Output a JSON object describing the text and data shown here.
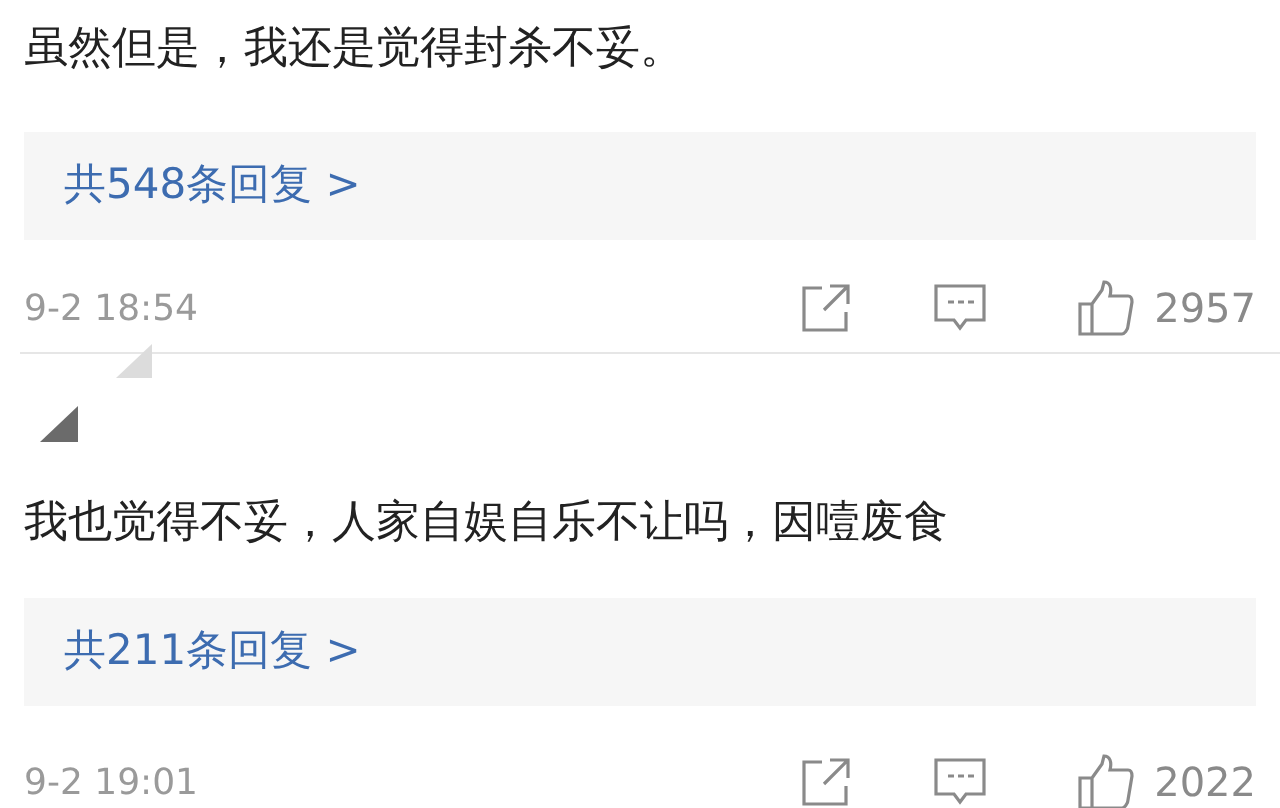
{
  "comments": [
    {
      "text": "虽然但是，我还是觉得封杀不妥。",
      "replies": "共548条回复 >",
      "time": "9-2 18:54",
      "likes": "2957"
    },
    {
      "text": "我也觉得不妥，人家自娱自乐不让吗，因噎废食",
      "replies": "共211条回复 >",
      "time": "9-2 19:01",
      "likes": "2022"
    }
  ]
}
